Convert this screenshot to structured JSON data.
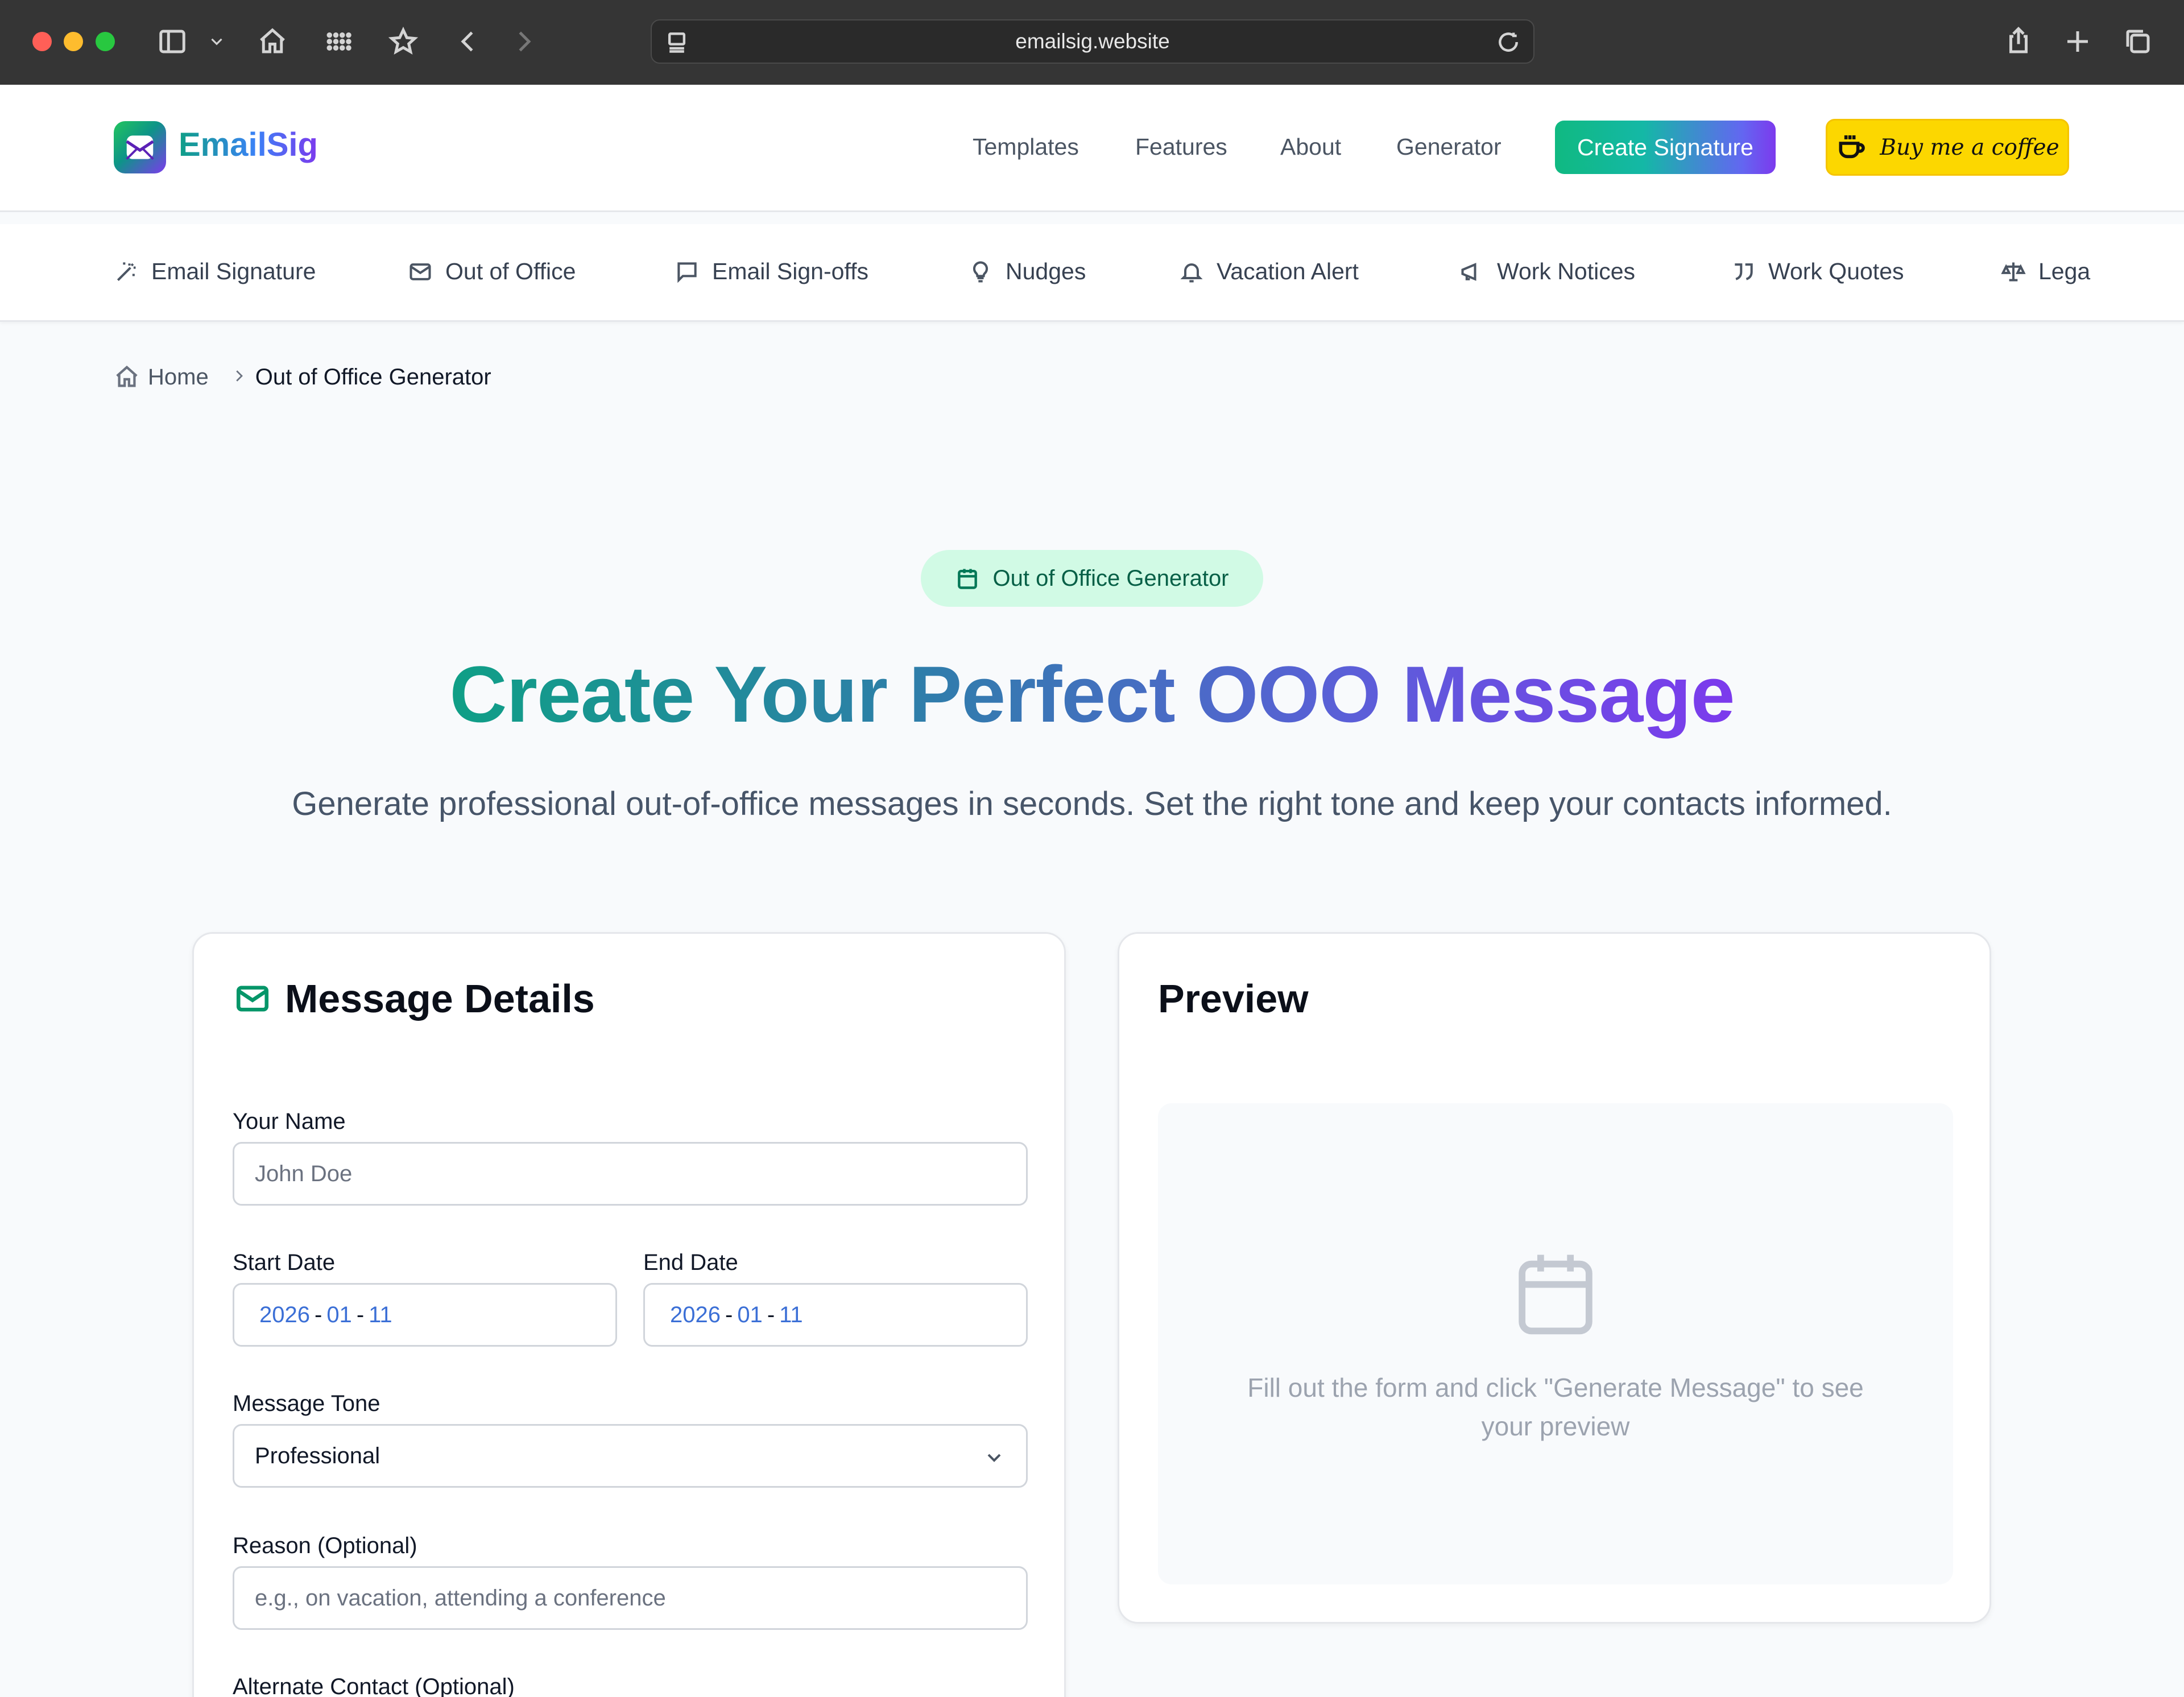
{
  "browser": {
    "url": "emailsig.website"
  },
  "header": {
    "logo_text": "EmailSig",
    "nav": [
      "Templates",
      "Features",
      "About",
      "Generator"
    ],
    "create_label": "Create Signature",
    "coffee_label": "Buy me a coffee"
  },
  "subnav": {
    "items": [
      {
        "label": "Email Signature",
        "icon": "wand-icon"
      },
      {
        "label": "Out of Office",
        "icon": "mail-icon"
      },
      {
        "label": "Email Sign-offs",
        "icon": "message-icon"
      },
      {
        "label": "Nudges",
        "icon": "lightbulb-icon"
      },
      {
        "label": "Vacation Alert",
        "icon": "bell-icon"
      },
      {
        "label": "Work Notices",
        "icon": "megaphone-icon"
      },
      {
        "label": "Work Quotes",
        "icon": "quote-icon"
      },
      {
        "label": "Lega",
        "icon": "scale-icon"
      }
    ]
  },
  "breadcrumb": {
    "home": "Home",
    "current": "Out of Office Generator"
  },
  "hero": {
    "badge": "Out of Office Generator",
    "title": "Create Your Perfect OOO Message",
    "subtitle": "Generate professional out-of-office messages in seconds. Set the right tone and keep your contacts informed."
  },
  "form": {
    "title": "Message Details",
    "name_label": "Your Name",
    "name_placeholder": "John Doe",
    "start_label": "Start Date",
    "start_date": {
      "year": "2026",
      "month": "01",
      "day": "11"
    },
    "end_label": "End Date",
    "end_date": {
      "year": "2026",
      "month": "01",
      "day": "11"
    },
    "tone_label": "Message Tone",
    "tone_value": "Professional",
    "reason_label": "Reason (Optional)",
    "reason_placeholder": "e.g., on vacation, attending a conference",
    "alternate_label": "Alternate Contact (Optional)"
  },
  "preview": {
    "title": "Preview",
    "empty_text": "Fill out the form and click \"Generate Message\" to see your preview"
  },
  "colors": {
    "accent_green": "#059669",
    "accent_purple": "#7c3aed",
    "coffee_yellow": "#fcd700"
  }
}
